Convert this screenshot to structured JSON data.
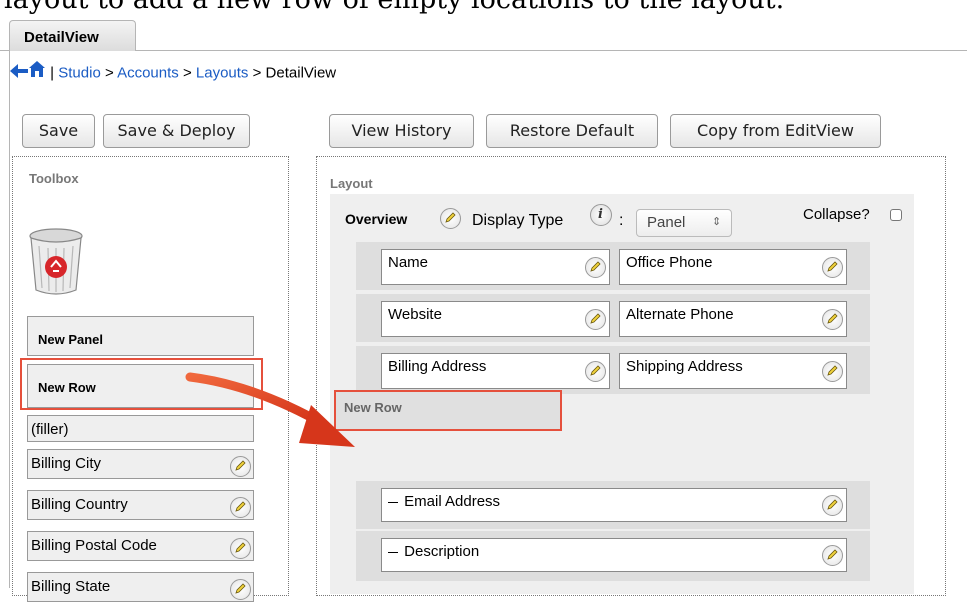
{
  "caption": "layout to add a new row of empty locations to the layout.",
  "tab": {
    "label": "DetailView"
  },
  "breadcrumb": {
    "separator": "|",
    "items": [
      "Studio",
      "Accounts",
      "Layouts",
      "DetailView"
    ],
    "arrow": ">"
  },
  "toolbar": {
    "save": "Save",
    "save_deploy": "Save & Deploy",
    "view_history": "View History",
    "restore_default": "Restore Default",
    "copy_from_editview": "Copy from EditView"
  },
  "toolbox": {
    "title": "Toolbox",
    "items": {
      "new_panel": "New Panel",
      "new_row": "New Row",
      "filler": "(filler)",
      "billing_city": "Billing City",
      "billing_country": "Billing Country",
      "billing_postal_code": "Billing Postal Code",
      "billing_state": "Billing State"
    }
  },
  "layout": {
    "title": "Layout",
    "panel_name": "Overview",
    "display_type_label": "Display Type",
    "display_type_colon": ":",
    "display_type_value": "Panel",
    "collapse_label": "Collapse?",
    "rows": [
      [
        "Name",
        "Office Phone"
      ],
      [
        "Website",
        "Alternate Phone"
      ],
      [
        "Billing Address",
        "Shipping Address"
      ]
    ],
    "new_row_label": "New Row",
    "single_rows": [
      "Email Address",
      "Description"
    ]
  },
  "colors": {
    "link": "#1b5cc4",
    "highlight": "#e5503c",
    "arrow": "#e0401f"
  }
}
